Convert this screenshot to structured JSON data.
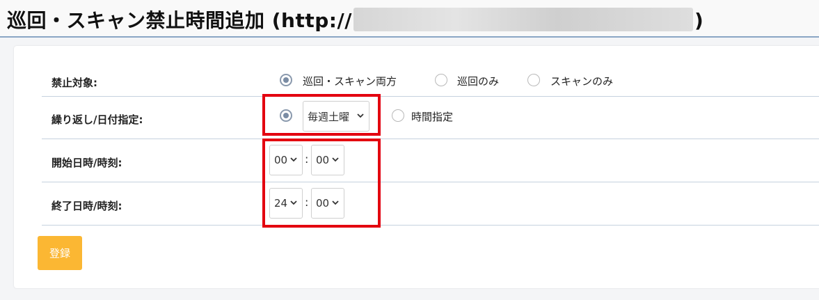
{
  "header": {
    "title_prefix": "巡回・スキャン禁止時間追加 (http://",
    "title_suffix": ")"
  },
  "form": {
    "target": {
      "label": "禁止対象:",
      "options": [
        "巡回・スキャン両方",
        "巡回のみ",
        "スキャンのみ"
      ],
      "selected": "巡回・スキャン両方"
    },
    "repeat": {
      "label": "繰り返し/日付指定:",
      "weekday_select": "毎週土曜",
      "option_time": "時間指定"
    },
    "start": {
      "label": "開始日時/時刻:",
      "hour": "00",
      "minute": "00",
      "separator": ":"
    },
    "end": {
      "label": "終了日時/時刻:",
      "hour": "24",
      "minute": "00",
      "separator": ":"
    },
    "submit_label": "登録"
  },
  "colors": {
    "accent_button": "#fbb733",
    "highlight_box": "#e3000f",
    "divider": "#c5d1de"
  }
}
